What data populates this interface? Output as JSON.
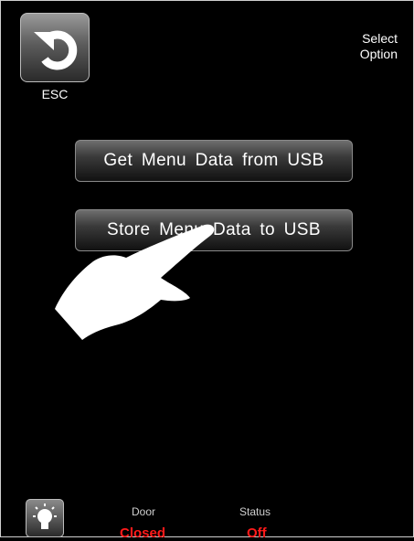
{
  "header": {
    "esc_label": "ESC",
    "title_line1": "Select",
    "title_line2": "Option"
  },
  "menu": {
    "buttons": [
      {
        "label": "Get Menu Data from USB"
      },
      {
        "label": "Store Menu Data to USB"
      }
    ]
  },
  "footer": {
    "door_label": "Door",
    "door_value": "Closed",
    "status_label": "Status",
    "status_value": "Off"
  },
  "colors": {
    "background": "#000000",
    "status_value": "#ff1a1a"
  },
  "icons": {
    "esc": "back-arrow-icon",
    "light": "lightbulb-icon",
    "hand": "pointing-hand-icon"
  }
}
